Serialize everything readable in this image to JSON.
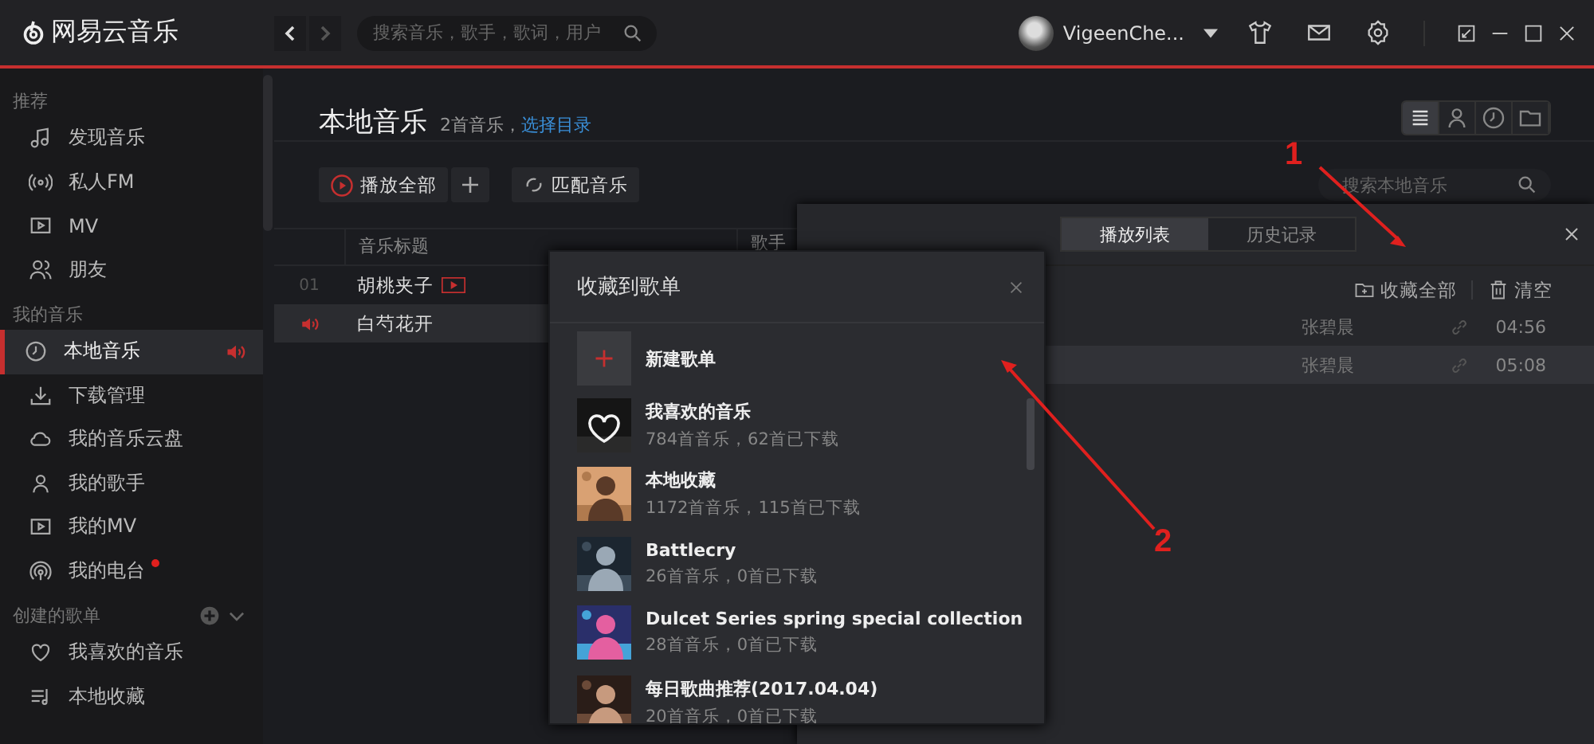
{
  "app": {
    "logo": "网易云音乐"
  },
  "search": {
    "placeholder": "搜索音乐，歌手，歌词，用户"
  },
  "user": {
    "name": "VigeenChe..."
  },
  "sidebar": {
    "sections": [
      {
        "title": "推荐",
        "kind": "plain",
        "items": [
          {
            "label": "发现音乐",
            "selected": false,
            "playing": false,
            "unread": false
          },
          {
            "label": "私人FM",
            "selected": false,
            "playing": false,
            "unread": false
          },
          {
            "label": "MV",
            "selected": false,
            "playing": false,
            "unread": false
          },
          {
            "label": "朋友",
            "selected": false,
            "playing": false,
            "unread": false
          }
        ]
      },
      {
        "title": "我的音乐",
        "kind": "plain",
        "items": [
          {
            "label": "本地音乐",
            "selected": true,
            "playing": true,
            "unread": false
          },
          {
            "label": "下载管理",
            "selected": false,
            "playing": false,
            "unread": false
          },
          {
            "label": "我的音乐云盘",
            "selected": false,
            "playing": false,
            "unread": false
          },
          {
            "label": "我的歌手",
            "selected": false,
            "playing": false,
            "unread": false
          },
          {
            "label": "我的MV",
            "selected": false,
            "playing": false,
            "unread": false
          },
          {
            "label": "我的电台",
            "selected": false,
            "playing": false,
            "unread": true
          }
        ]
      },
      {
        "title": "创建的歌单",
        "kind": "created",
        "items": [
          {
            "label": "我喜欢的音乐",
            "selected": false,
            "playing": false,
            "unread": false
          },
          {
            "label": "本地收藏",
            "selected": false,
            "playing": false,
            "unread": false
          }
        ]
      }
    ]
  },
  "main": {
    "title": "本地音乐",
    "count": "2首音乐，",
    "link": "选择目录",
    "play_all": "播放全部",
    "match": "匹配音乐",
    "search": {
      "placeholder": "搜索本地音乐"
    },
    "views": [
      {
        "selected": true
      },
      {
        "selected": false
      },
      {
        "selected": false
      },
      {
        "selected": false
      }
    ],
    "columns": [
      "音乐标题",
      "歌手"
    ],
    "rows": [
      {
        "index": "01",
        "title": "胡桃夹子",
        "mv": true,
        "playing": false,
        "selected": false
      },
      {
        "index": "",
        "title": "白芍花开",
        "mv": false,
        "playing": true,
        "selected": true
      }
    ]
  },
  "playlist": {
    "tabs": [
      {
        "label": "播放列表",
        "selected": true
      },
      {
        "label": "历史记录",
        "selected": false
      }
    ],
    "collect_all": "收藏全部",
    "clear": "清空",
    "rows": [
      {
        "artist": "张碧晨",
        "duration": "04:56",
        "selected": false
      },
      {
        "artist": "张碧晨",
        "duration": "05:08",
        "selected": true
      }
    ]
  },
  "dialog": {
    "title": "收藏到歌单",
    "new": "新建歌单",
    "items": [
      {
        "name": "我喜欢的音乐",
        "info": "784首音乐，62首已下载"
      },
      {
        "name": "本地收藏",
        "info": "1172首音乐，115首已下载"
      },
      {
        "name": "Battlecry",
        "info": "26首音乐，0首已下载"
      },
      {
        "name": "Dulcet Series spring special collection",
        "info": "28首音乐，0首已下载"
      },
      {
        "name": "每日歌曲推荐(2017.04.04)",
        "info": "20首音乐，0首已下载"
      }
    ]
  },
  "annotations": [
    {
      "label": "1"
    },
    {
      "label": "2"
    }
  ]
}
